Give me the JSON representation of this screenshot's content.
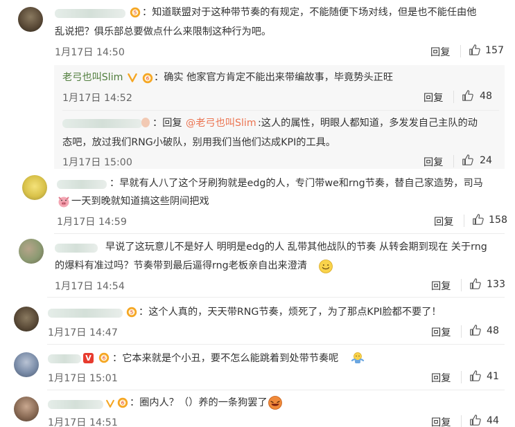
{
  "comments": [
    {
      "text_line1": "：知道联盟对于这种带节奏的有规定，不能随便下场对线，但是也不能任由他",
      "text_line2": "乱说把？俱乐部总要做点什么来限制这种行为吧。",
      "time": "1月17日 14:50",
      "reply": "回复",
      "likes": "157"
    },
    {
      "name": "老弓也叫Slim",
      "text": "：确实 他家官方肯定不能出来带编故事，毕竟势头正旺",
      "time": "1月17日 14:52",
      "reply": "回复",
      "likes": "48"
    },
    {
      "prefix": "：回复",
      "mention": "@老弓也叫Slim",
      "text_line1": ":这人的属性，明眼人都知道，多发发自己主队的动",
      "text_line2": "态吧，放过我们RNG小破队，别用我们当他们达成KPI的工具。",
      "time": "1月17日 15:00",
      "reply": "回复",
      "likes": "24"
    },
    {
      "text_line1": "：早就有人八了这个牙刷狗就是edg的人，专门带we和rng节奏，替自己家造势，司马",
      "text_line2": "一天到晚就知道搞这些阴间把戏",
      "time": "1月17日 14:59",
      "reply": "回复",
      "likes": "158"
    },
    {
      "text_line1": "早说了这玩意儿不是好人 明明是edg的人 乱带其他战队的节奏 从转会期到现在 关于rng",
      "text_line2": "的爆料有准过吗？节奏带到最后逼得rng老板亲自出来澄清",
      "time": "1月17日 14:54",
      "reply": "回复",
      "likes": "133"
    },
    {
      "text": "：这个人真的，天天带RNG节奏，烦死了，为了那点KPI脸都不要了！",
      "time": "1月17日 14:47",
      "reply": "回复",
      "likes": "48"
    },
    {
      "vbadge": "V",
      "text": "：它本来就是个小丑，要不怎么能跳着到处带节奏呢",
      "time": "1月17日 15:01",
      "reply": "回复",
      "likes": "41"
    },
    {
      "text": "：圈内人？（）养的一条狗罢了",
      "time": "1月17日 14:51",
      "reply": "回复",
      "likes": "44"
    }
  ],
  "colors": {
    "name_green": "#507d3c",
    "mention_orange": "#eb7350",
    "time_gray": "#666666",
    "subreply_bg": "#f7f7f7"
  },
  "icons": [
    "thumb-up-icon",
    "vip-badge-icon",
    "smile-emoji-icon",
    "pig-emoji-icon",
    "shrug-emoji-icon",
    "laugh-emoji-icon",
    "verified-v-icon"
  ]
}
